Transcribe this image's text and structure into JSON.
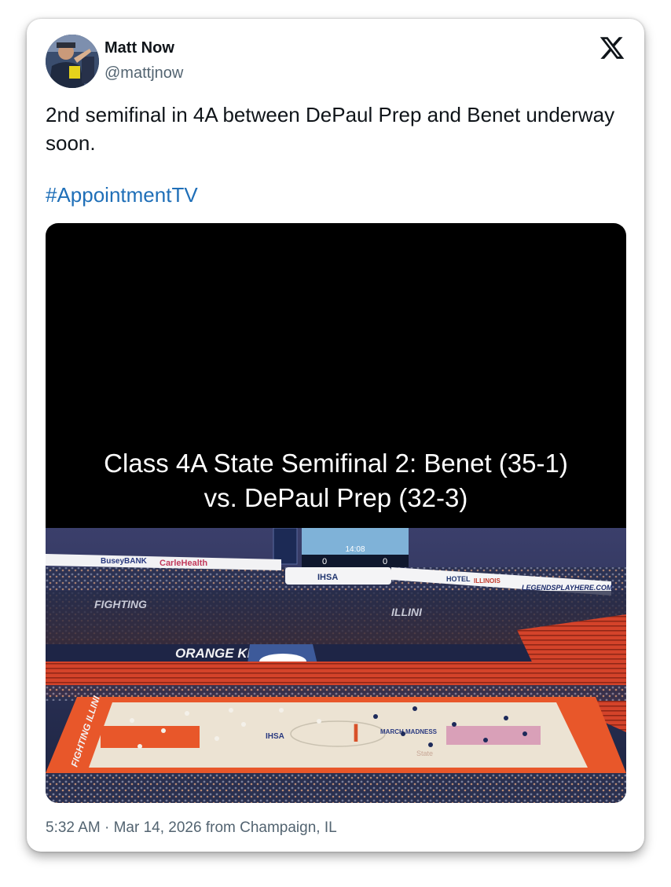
{
  "user": {
    "name": "Matt Now",
    "handle": "@mattjnow"
  },
  "tweet": {
    "text": "2nd semifinal in 4A between DePaul Prep and Benet underway soon.",
    "hashtag": "#AppointmentTV"
  },
  "media": {
    "caption_line1": "Class 4A State Semifinal 2: Benet (35-1)",
    "caption_line2": "vs. DePaul Prep (32-3)",
    "scoreboard": {
      "clock": "14:08",
      "home_score": "0",
      "away_score": "0"
    },
    "signage": {
      "busey": "BuseyBANK",
      "carle": "CarleHealth",
      "ihsa": "IHSA",
      "hotel": "HOTEL",
      "illinois": "ILLINOIS",
      "legends": "LEGENDSPLAYHERE.COM",
      "orange_krush": "ORANGE KRUSH",
      "fighting": "FIGHTING",
      "fighting_illini": "FIGHTING ILLINI",
      "illini": "ILLINI",
      "march_madness": "MARCH MADNESS",
      "state": "State"
    }
  },
  "meta": {
    "timestamp": "5:32 AM · Mar 14, 2026 from Champaign, IL"
  },
  "icons": {
    "logo": "x-logo-icon"
  },
  "colors": {
    "name": "#0f1419",
    "secondary": "#536471",
    "link": "#1f6fb8",
    "court_orange": "#e8572a",
    "arena_blue": "#1b2340"
  }
}
